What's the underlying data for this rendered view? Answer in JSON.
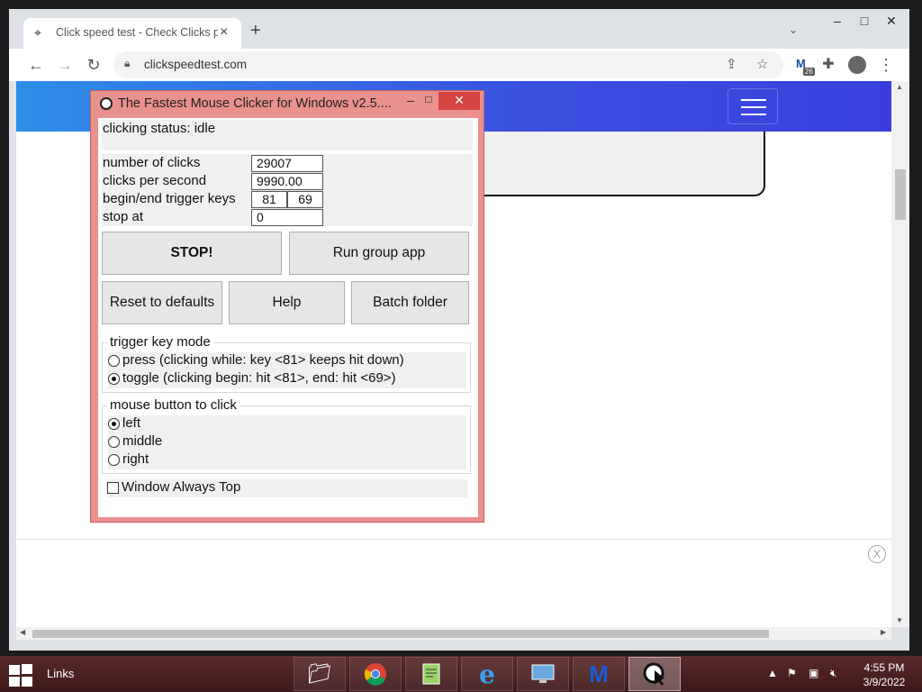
{
  "browser": {
    "tab_title": "Click speed test - Check Clicks p",
    "tab_icon": "cursor-click-icon",
    "new_tab": "+",
    "tab_search": "⌄",
    "url": "clickspeedtest.com",
    "extension_badge": "26"
  },
  "window_controls": {
    "minimize": "–",
    "maximize": "□",
    "close": "✕"
  },
  "app": {
    "title": "The Fastest Mouse Clicker for Windows v2.5....",
    "status": "clicking status: idle",
    "stats": {
      "clicks_label": "number of clicks",
      "clicks_value": "29007",
      "cps_label": "clicks per second",
      "cps_value": "9990.00",
      "trigger_label": "begin/end trigger keys",
      "trigger_begin": "81",
      "trigger_end": "69",
      "stop_label": "stop at",
      "stop_value": "0"
    },
    "buttons": {
      "stop": "STOP!",
      "run_group": "Run group app",
      "reset": "Reset to defaults",
      "help": "Help",
      "batch": "Batch folder"
    },
    "trigger_mode": {
      "title": "trigger key mode",
      "press": "press (clicking while: key <81> keeps hit down)",
      "toggle": "toggle (clicking begin: hit <81>, end: hit <69>)",
      "selected": "toggle"
    },
    "mouse_button": {
      "title": "mouse button to click",
      "left": "left",
      "middle": "middle",
      "right": "right",
      "selected": "left"
    },
    "always_top": {
      "label": "Window Always Top",
      "checked": false
    }
  },
  "taskbar": {
    "links": "Links",
    "apps": [
      "file-explorer-icon",
      "chrome-icon",
      "notepad-plus-icon",
      "internet-explorer-icon",
      "control-panel-icon",
      "malwarebytes-icon",
      "mouse-clicker-icon"
    ],
    "time": "4:55 PM",
    "date": "3/9/2022"
  },
  "colors": {
    "app_frame": "#e8918e",
    "app_close": "#d64541",
    "site_header": "#3a4fe0",
    "taskbar": "#4a2020"
  }
}
